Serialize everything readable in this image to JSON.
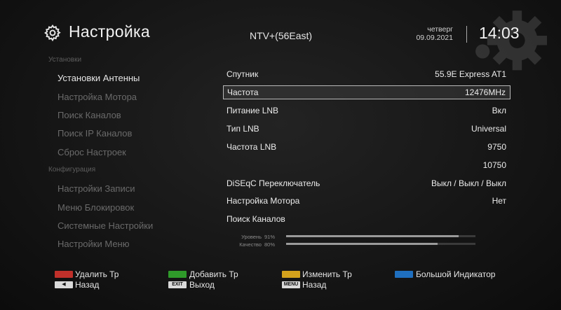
{
  "header": {
    "title": "Настройка",
    "channel": "NTV+(56East)",
    "day": "четверг",
    "date": "09.09.2021",
    "time": "14:03"
  },
  "sidebar": {
    "section_install": "Установки",
    "section_config": "Конфигурация",
    "items": [
      {
        "label": "Установки Антенны"
      },
      {
        "label": "Настройка Мотора"
      },
      {
        "label": "Поиск Каналов"
      },
      {
        "label": "Поиск IP Каналов"
      },
      {
        "label": "Сброс Настроек"
      },
      {
        "label": "Настройки Записи"
      },
      {
        "label": "Меню Блокировок"
      },
      {
        "label": "Системные Настройки"
      },
      {
        "label": "Настройки Меню"
      }
    ]
  },
  "settings": {
    "rows": [
      {
        "label": "Спутник",
        "value": "55.9E Express AT1"
      },
      {
        "label": "Частота",
        "value": "12476MHz"
      },
      {
        "label": "Питание LNB",
        "value": "Вкл"
      },
      {
        "label": "Тип LNB",
        "value": "Universal"
      },
      {
        "label": "Частота LNB",
        "value": "9750"
      },
      {
        "label": "",
        "value": "10750"
      },
      {
        "label": "DiSEqC Переключатель",
        "value": "Выкл / Выкл / Выкл"
      },
      {
        "label": "Настройка Мотора",
        "value": "Нет"
      },
      {
        "label": "Поиск Каналов",
        "value": ""
      }
    ],
    "selected_index": 1
  },
  "signal": {
    "level_label": "Уровень",
    "level_pct": "91%",
    "level_value": 0.91,
    "quality_label": "Качество",
    "quality_pct": "80%",
    "quality_value": 0.8
  },
  "footer": {
    "red_label": "Удалить Тр",
    "green_label": "Добавить Тр",
    "yellow_label": "Изменить Тр",
    "blue_label": "Большой Индикатор",
    "back_label": "Назад",
    "exit_key": "EXIT",
    "exit_label": "Выход",
    "menu_key": "MENU",
    "menu_back_label": "Назад",
    "colors": {
      "red": "#c0302a",
      "green": "#2f9a2a",
      "yellow": "#d4a21c",
      "blue": "#1f6fbf"
    }
  }
}
